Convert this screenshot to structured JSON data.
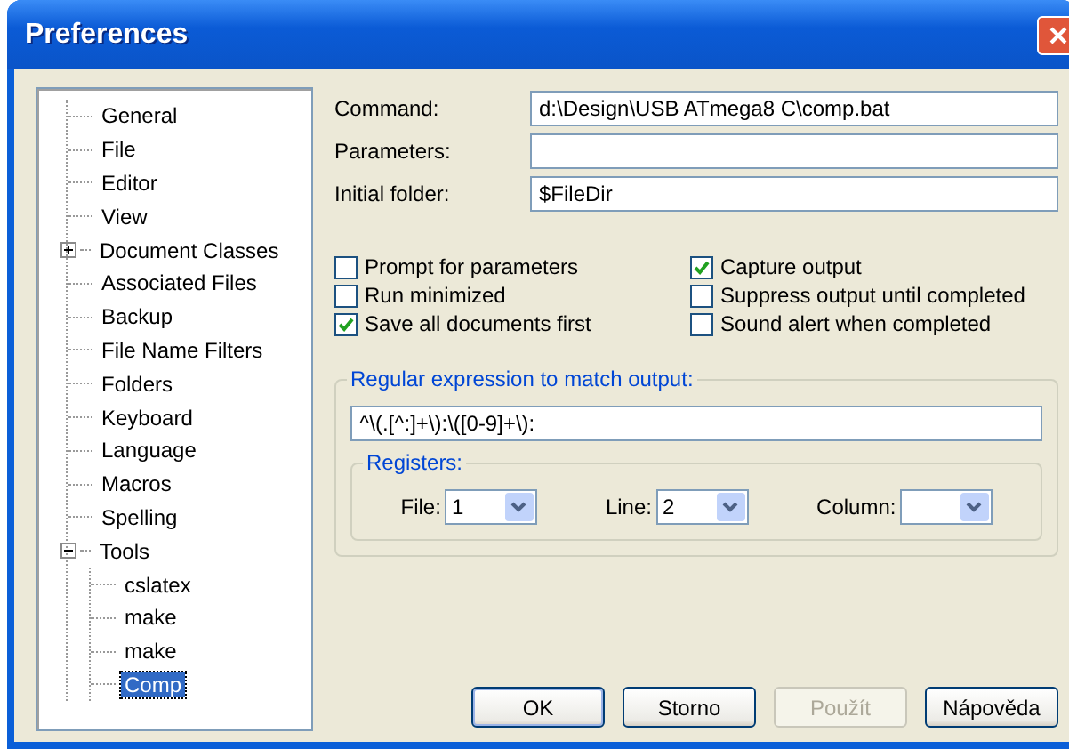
{
  "window": {
    "title": "Preferences"
  },
  "tree": [
    {
      "label": "General",
      "selected": false
    },
    {
      "label": "File",
      "selected": false
    },
    {
      "label": "Editor",
      "selected": false
    },
    {
      "label": "View",
      "selected": false
    },
    {
      "label": "Document Classes",
      "selected": false,
      "expanded": false
    },
    {
      "label": "Associated Files",
      "selected": false
    },
    {
      "label": "Backup",
      "selected": false
    },
    {
      "label": "File Name Filters",
      "selected": false
    },
    {
      "label": "Folders",
      "selected": false
    },
    {
      "label": "Keyboard",
      "selected": false
    },
    {
      "label": "Language",
      "selected": false
    },
    {
      "label": "Macros",
      "selected": false
    },
    {
      "label": "Spelling",
      "selected": false
    },
    {
      "label": "Tools",
      "selected": false,
      "expanded": true,
      "children": [
        {
          "label": "cslatex",
          "selected": false
        },
        {
          "label": "make",
          "selected": false
        },
        {
          "label": "make",
          "selected": false
        },
        {
          "label": "Comp",
          "selected": true
        }
      ]
    }
  ],
  "fields": [
    {
      "label": "Command:",
      "value": "d:\\Design\\USB ATmega8 C\\comp.bat"
    },
    {
      "label": "Parameters:"
    },
    {
      "label": "Initial folder:",
      "value": "$FileDir"
    }
  ],
  "options": [
    {
      "label": "Prompt for parameters",
      "checked": false
    },
    {
      "label": "Capture output",
      "checked": true
    },
    {
      "label": "Run minimized",
      "checked": false
    },
    {
      "label": "Suppress output until completed",
      "checked": false
    },
    {
      "label": "Save all documents first",
      "checked": true
    },
    {
      "label": "Sound alert when completed",
      "checked": false
    }
  ],
  "regex_group": {
    "title": "Regular expression to match output:",
    "value": "^\\(.[^:]+\\):\\([0-9]+\\):"
  },
  "registers": {
    "title": "Registers:",
    "selects": [
      {
        "label": "File:",
        "value": "1"
      },
      {
        "label": "Line:",
        "value": "2"
      },
      {
        "label": "Column:"
      }
    ]
  },
  "buttons": [
    {
      "label": "OK",
      "default": true,
      "disabled": false
    },
    {
      "label": "Storno",
      "default": false,
      "disabled": false
    },
    {
      "label": "Použít",
      "default": false,
      "disabled": true
    },
    {
      "label": "Nápověda",
      "default": false,
      "disabled": false
    }
  ]
}
